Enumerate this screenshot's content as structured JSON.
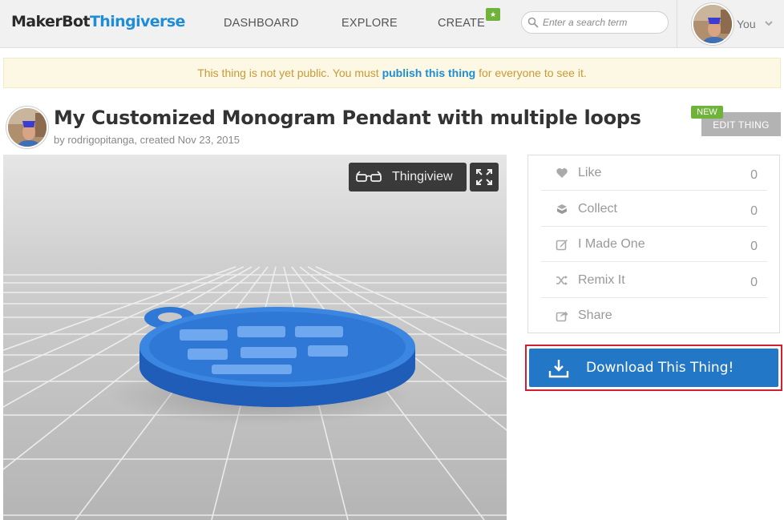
{
  "header": {
    "logo_left": "MakerBot",
    "logo_right": "Thingiverse",
    "nav": {
      "dashboard": "DASHBOARD",
      "explore": "EXPLORE",
      "create": "CREATE"
    },
    "create_badge": "★",
    "search_placeholder": "Enter a search term",
    "user_label": "You"
  },
  "notice": {
    "prefix": "This thing is not yet public. You must ",
    "link": "publish this thing",
    "suffix": " for everyone to see it."
  },
  "thing": {
    "title": "My Customized Monogram Pendant with multiple loops",
    "byline": "by rodrigopitanga, created Nov 23, 2015",
    "edit_label": "EDIT THING",
    "new_badge": "NEW"
  },
  "viewer": {
    "thingiview_label": "Thingiview"
  },
  "actions": [
    {
      "label": "Like",
      "count": "0",
      "icon": "heart-icon"
    },
    {
      "label": "Collect",
      "count": "0",
      "icon": "collect-icon"
    },
    {
      "label": "I Made One",
      "count": "0",
      "icon": "made-icon"
    },
    {
      "label": "Remix It",
      "count": "0",
      "icon": "shuffle-icon"
    },
    {
      "label": "Share",
      "count": "",
      "icon": "share-icon"
    }
  ],
  "download": {
    "label": "Download This Thing!",
    "accent": "#2277c6",
    "highlight": "#d0202f"
  },
  "colors": {
    "brand_blue": "#1f8dd6",
    "pendant_blue": "#2f78d6",
    "new_green": "#6fb33a"
  }
}
